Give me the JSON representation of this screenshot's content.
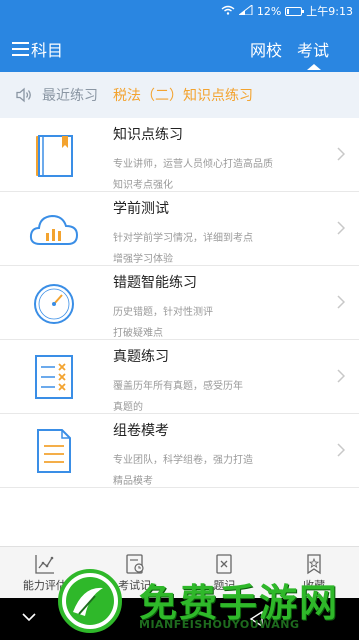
{
  "status_bar": {
    "battery_text": "12%",
    "battery_level": 0.12,
    "time": "上午9:13"
  },
  "header": {
    "subject_label": "科目",
    "tabs": [
      {
        "label": "网校",
        "active": false
      },
      {
        "label": "考试",
        "active": true
      }
    ]
  },
  "recent": {
    "label": "最近练习",
    "topic": "税法（二）知识点练习"
  },
  "items": [
    {
      "title": "知识点练习",
      "desc1": "专业讲师，运营人员倾心打造高品质",
      "desc2": "知识考点强化",
      "icon": "book-icon"
    },
    {
      "title": "学前测试",
      "desc1": "针对学前学习情况，详细到考点",
      "desc2": "增强学习体验",
      "icon": "cloud-chart-icon"
    },
    {
      "title": "错题智能练习",
      "desc1": "历史错题，针对性测评",
      "desc2": "打破疑难点",
      "icon": "gauge-icon"
    },
    {
      "title": "真题练习",
      "desc1": "覆盖历年所有真题，感受历年",
      "desc2": "真题的",
      "icon": "checklist-icon"
    },
    {
      "title": "组卷模考",
      "desc1": "专业团队，科学组卷，强力打造",
      "desc2": "精品模考",
      "icon": "document-icon"
    }
  ],
  "bottom_nav": [
    {
      "label": "能力评估"
    },
    {
      "label": "考试记"
    },
    {
      "label": "题记"
    },
    {
      "label": "收藏"
    }
  ],
  "watermark": {
    "title": "免费手游网",
    "subtitle": "MIANFEISHOUYOUWANG"
  },
  "colors": {
    "primary": "#2a86e1",
    "accent": "#f3a32f",
    "icon_blue": "#3a8ee6",
    "icon_orange": "#f3a32f"
  }
}
